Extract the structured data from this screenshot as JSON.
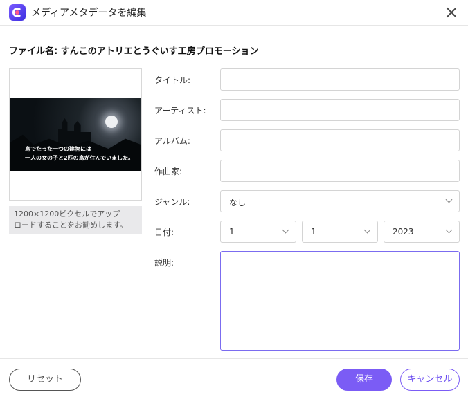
{
  "window": {
    "title": "メディアメタデータを編集"
  },
  "file": {
    "name_line": "ファイル名: すんこのアトリエとうぐいす工房プロモーション"
  },
  "preview": {
    "subtitle_line1": "島でたった一つの建物には",
    "subtitle_line2": "一人の女の子と2匹の鳥が住んでいました。",
    "hint_line1": "1200×1200ピクセルでアップ",
    "hint_line2": "ロードすることをお勧めします。"
  },
  "fields": {
    "title_label": "タイトル:",
    "title_value": "",
    "artist_label": "アーティスト:",
    "artist_value": "",
    "album_label": "アルバム:",
    "album_value": "",
    "composer_label": "作曲家:",
    "composer_value": "",
    "genre_label": "ジャンル:",
    "genre_value": "なし",
    "date_label": "日付:",
    "date_month": "1",
    "date_day": "1",
    "date_year": "2023",
    "description_label": "説明:",
    "description_value": ""
  },
  "buttons": {
    "reset": "リセット",
    "save": "保存",
    "cancel": "キャンセル"
  },
  "colors": {
    "accent": "#7b5cf5",
    "hint_bg": "#e9e9eb",
    "border": "#d4d4d4"
  }
}
